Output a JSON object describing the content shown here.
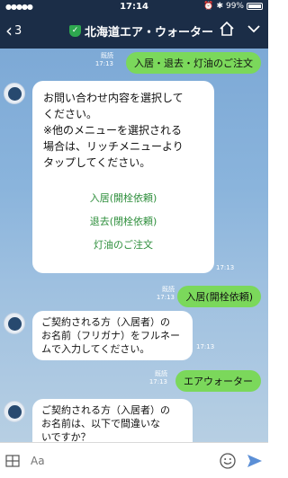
{
  "statusbar": {
    "time": "17:14",
    "battery": "99%"
  },
  "navbar": {
    "back_count": "3",
    "title": "北海道エア・ウォーター"
  },
  "chat": {
    "messages": [
      {
        "kind": "out",
        "read": "既読",
        "time": "17:13",
        "text": "入居・退去・灯油のご注文"
      },
      {
        "kind": "in-card",
        "time": "17:13",
        "intro": [
          "お問い合わせ内容を選択して",
          "ください。",
          "※他のメニューを選択される",
          "場合は、リッチメニューより",
          "タップしてください。"
        ],
        "options": [
          "入居(開栓依頼)",
          "退去(閉栓依頼)",
          "灯油のご注文"
        ]
      },
      {
        "kind": "out",
        "read": "既読",
        "time": "17:13",
        "text": "入居(開栓依頼)"
      },
      {
        "kind": "in",
        "time": "17:13",
        "lines": [
          "ご契約される方（入居者）の",
          "お名前（フリガナ）をフルネー",
          "ムで入力してください。"
        ]
      },
      {
        "kind": "out",
        "read": "既読",
        "time": "17:13",
        "text": "エアウォーター"
      },
      {
        "kind": "in",
        "time": "",
        "lines": [
          "ご契約される方（入居者）の",
          "お名前は、以下で間違いな",
          "いですか？"
        ]
      }
    ]
  },
  "input": {
    "placeholder": "Aa"
  }
}
